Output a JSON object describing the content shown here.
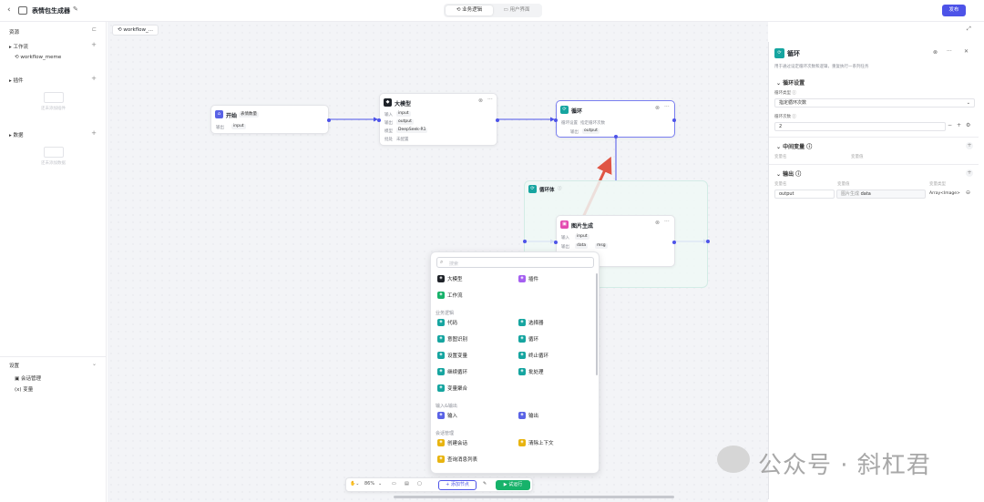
{
  "header": {
    "title": "表情包生成器",
    "tabs": [
      {
        "label": "业务逻辑",
        "active": true
      },
      {
        "label": "用户界面",
        "active": false
      }
    ],
    "publish_label": "发布"
  },
  "sidebar": {
    "resources_label": "资源",
    "sections": [
      {
        "label": "工作流",
        "items": [
          "workflow_meme"
        ]
      },
      {
        "label": "插件",
        "empty": "还未添加插件"
      },
      {
        "label": "数据",
        "empty": "还未添加数据"
      }
    ],
    "settings_label": "设置",
    "settings_items": [
      "会话管理",
      "变量"
    ]
  },
  "canvas": {
    "workflow_tab": "workflow_...",
    "nodes": {
      "start": {
        "title": "开始",
        "badge": "表情数量",
        "input_label": "输出",
        "chip": "input"
      },
      "llm": {
        "title": "大模型",
        "rows": [
          {
            "label": "输入",
            "chip": "input"
          },
          {
            "label": "输出",
            "chip": "output"
          },
          {
            "label": "模型",
            "chip": "DeepSeek-R1"
          },
          {
            "label": "批处",
            "chip": "未配置"
          }
        ]
      },
      "loop": {
        "title": "循环",
        "rows": [
          {
            "label": "循环设置",
            "value": "指定循环次数"
          },
          {
            "label": "输出",
            "chip": "output"
          }
        ]
      },
      "loop_body": {
        "title": "循环体"
      },
      "image": {
        "title": "图片生成",
        "rows": [
          {
            "label": "输入",
            "chip": "input"
          },
          {
            "label": "输出",
            "chip": "data",
            "chip2": "msg"
          }
        ]
      }
    }
  },
  "add_menu": {
    "search_placeholder": "搜索",
    "top_items": [
      {
        "label": "大模型",
        "color": "#1f2329"
      },
      {
        "label": "插件",
        "color": "#a55ff0"
      },
      {
        "label": "工作流",
        "color": "#17b26a"
      }
    ],
    "sections": [
      {
        "label": "业务逻辑",
        "items": [
          {
            "label": "代码",
            "color": "#16a5a0"
          },
          {
            "label": "选择器",
            "color": "#16a5a0"
          },
          {
            "label": "意图识别",
            "color": "#16a5a0"
          },
          {
            "label": "循环",
            "color": "#16a5a0"
          },
          {
            "label": "设置变量",
            "color": "#16a5a0"
          },
          {
            "label": "终止循环",
            "color": "#16a5a0"
          },
          {
            "label": "继续循环",
            "color": "#16a5a0"
          },
          {
            "label": "批处理",
            "color": "#16a5a0"
          },
          {
            "label": "变量聚合",
            "color": "#16a5a0"
          }
        ]
      },
      {
        "label": "输入&输出",
        "items": [
          {
            "label": "输入",
            "color": "#5a63e6"
          },
          {
            "label": "输出",
            "color": "#5a63e6"
          }
        ]
      },
      {
        "label": "会话管理",
        "items": [
          {
            "label": "创建会话",
            "color": "#e8b410"
          },
          {
            "label": "清除上下文",
            "color": "#e8b410"
          },
          {
            "label": "查询消息列表",
            "color": "#e8b410"
          }
        ]
      },
      {
        "label": "知识库&数据",
        "items": []
      }
    ]
  },
  "toolbar": {
    "zoom": "86%",
    "add_node_label": "+ 添加节点",
    "run_label": "▶ 试运行"
  },
  "panel": {
    "title": "循环",
    "description": "用于通过设定循环次数和逻辑，重复执行一系列任务",
    "loop_settings_label": "循环设置",
    "loop_type_label": "循环类型",
    "loop_type_value": "指定循环次数",
    "loop_count_label": "循环次数",
    "loop_count_value": "2",
    "intermediate_label": "中间变量",
    "var_name_col": "变量名",
    "var_value_col": "变量值",
    "output_label": "输出",
    "output_cols": [
      "变量名",
      "变量值",
      "变量类型"
    ],
    "output_row": {
      "name": "output",
      "ref_prefix": "图片生成",
      "ref": "data",
      "type": "Array<Image>"
    }
  },
  "watermark": "公众号 · 斜杠君"
}
